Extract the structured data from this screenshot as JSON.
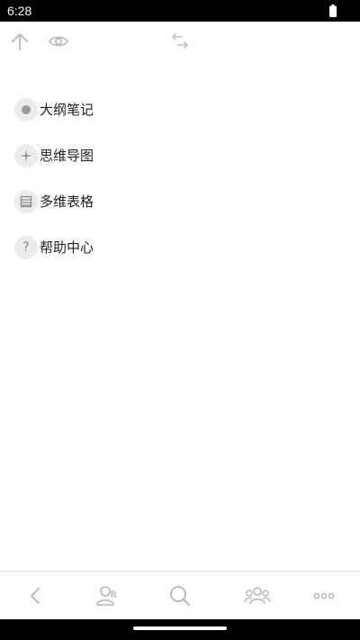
{
  "status_bar": {
    "time": "6:28",
    "battery_icon": "battery-full-icon"
  },
  "toolbar": {
    "icons": [
      "arrow-up-icon",
      "eye-icon",
      "swap-arrows-icon"
    ]
  },
  "menu": {
    "items": [
      {
        "label": "大纲笔记",
        "icon": "dot-icon"
      },
      {
        "label": "思维导图",
        "icon": "sparkle-icon"
      },
      {
        "label": "多维表格",
        "icon": "table-icon"
      },
      {
        "label": "帮助中心",
        "icon": "question-icon",
        "glyph": "?"
      }
    ]
  },
  "bottom_nav": {
    "icons": [
      "back-icon",
      "profile-icon",
      "search-icon",
      "group-icon",
      "more-icon"
    ],
    "profile_badge": "我"
  },
  "colors": {
    "icon_gray": "#b8b8b8",
    "menu_icon_bg": "#ececec",
    "text": "#1e1e1e"
  }
}
